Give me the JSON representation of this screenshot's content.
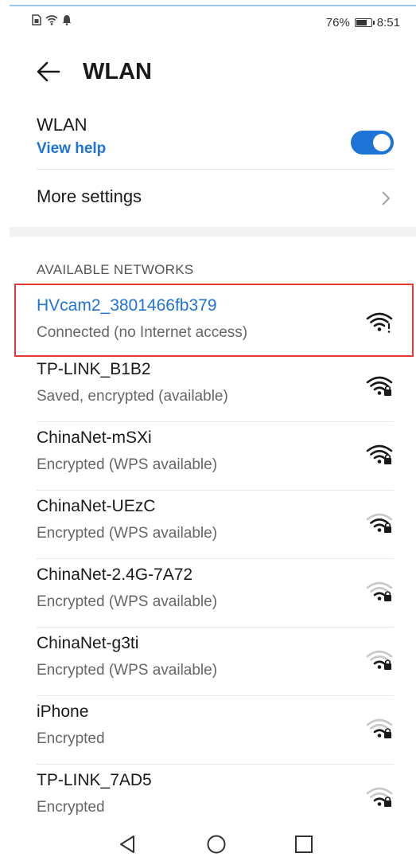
{
  "status_bar": {
    "battery_percent": "76%",
    "battery_level": 0.76,
    "time": "8:51",
    "icons": [
      "sim-icon",
      "wifi-icon",
      "notification-bell-icon"
    ]
  },
  "header": {
    "title": "WLAN",
    "back_icon": "arrow-left-icon"
  },
  "wlan": {
    "label": "WLAN",
    "help_link": "View help",
    "enabled": true
  },
  "more_settings": {
    "label": "More settings",
    "icon": "chevron-right-icon"
  },
  "section_title": "AVAILABLE NETWORKS",
  "networks": [
    {
      "name": "HVcam2_3801466fb379",
      "status": "Connected (no Internet access)",
      "signal": 4,
      "locked": false,
      "connected": true
    },
    {
      "name": "TP-LINK_B1B2",
      "status": "Saved, encrypted (available)",
      "signal": 4,
      "locked": true,
      "connected": false
    },
    {
      "name": "ChinaNet-mSXi",
      "status": "Encrypted (WPS available)",
      "signal": 4,
      "locked": true,
      "connected": false
    },
    {
      "name": "ChinaNet-UEzC",
      "status": "Encrypted (WPS available)",
      "signal": 3,
      "locked": true,
      "connected": false
    },
    {
      "name": "ChinaNet-2.4G-7A72",
      "status": "Encrypted (WPS available)",
      "signal": 2,
      "locked": true,
      "connected": false
    },
    {
      "name": "ChinaNet-g3ti",
      "status": "Encrypted (WPS available)",
      "signal": 2,
      "locked": true,
      "connected": false
    },
    {
      "name": "iPhone",
      "status": "Encrypted",
      "signal": 2,
      "locked": true,
      "connected": false
    },
    {
      "name": "TP-LINK_7AD5",
      "status": "Encrypted",
      "signal": 2,
      "locked": true,
      "connected": false
    }
  ],
  "nav": {
    "back": "triangle-back-icon",
    "home": "circle-home-icon",
    "recents": "square-recents-icon"
  },
  "colors": {
    "accent": "#1e73d6",
    "highlight": "#e53935"
  }
}
